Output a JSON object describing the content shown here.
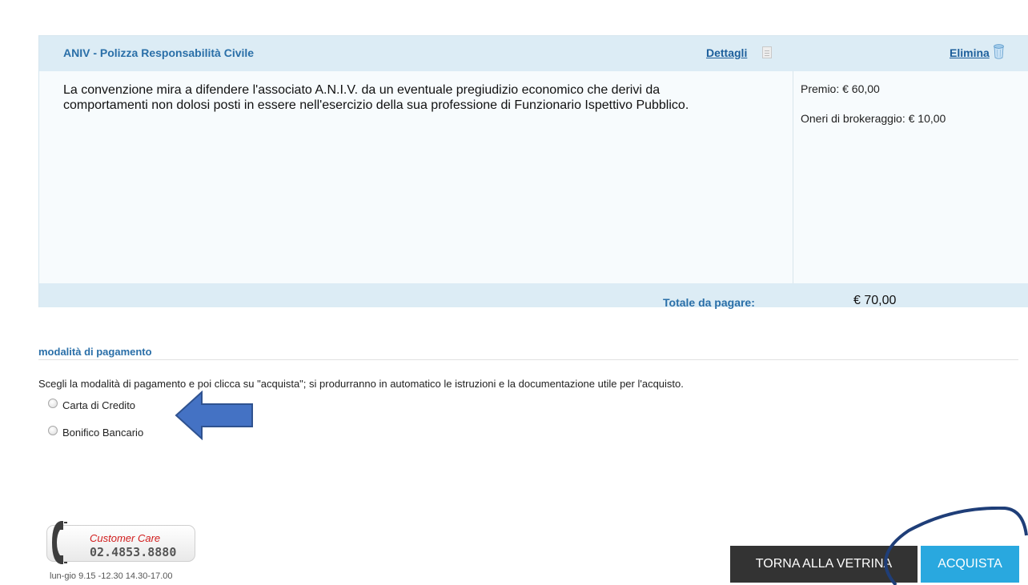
{
  "product": {
    "title": "ANIV - Polizza Responsabilità Civile",
    "details_label": "Dettagli",
    "delete_label": "Elimina",
    "description": "La convenzione mira a difendere l'associato A.N.I.V. da un eventuale pregiudizio economico che derivi da comportamenti non dolosi posti in essere nell'esercizio della sua professione di Funzionario Ispettivo Pubblico.",
    "premio": "Premio: € 60,00",
    "oneri": "Oneri di brokeraggio: € 10,00",
    "total_label": "Totale da pagare:",
    "total_value": "€ 70,00"
  },
  "payment": {
    "section_title": "modalità di pagamento",
    "instructions": "Scegli la modalità di pagamento e poi clicca su \"acquista\"; si produrranno in automatico le istruzioni e la documentazione utile per l'acquisto.",
    "options": [
      {
        "label": "Carta di Credito",
        "selected": false
      },
      {
        "label": "Bonifico Bancario",
        "selected": false
      }
    ]
  },
  "customer_care": {
    "title": "Customer Care",
    "phone": "02.4853.8880",
    "hours": "lun-gio 9.15 -12.30 14.30-17.00"
  },
  "actions": {
    "back_label": "TORNA ALLA VETRINA",
    "buy_label": "ACQUISTA"
  },
  "colors": {
    "accent_blue": "#29a8df",
    "dark_button": "#333333",
    "header_blue": "#dcecf5",
    "title_blue": "#2a6fa8",
    "annotation_arrow": "#4472c4",
    "annotation_circle": "#1f3e78"
  },
  "icons": {
    "details": "document-icon",
    "delete": "trash-icon",
    "phone": "phone-icon",
    "annotation": "arrow-left-icon"
  }
}
